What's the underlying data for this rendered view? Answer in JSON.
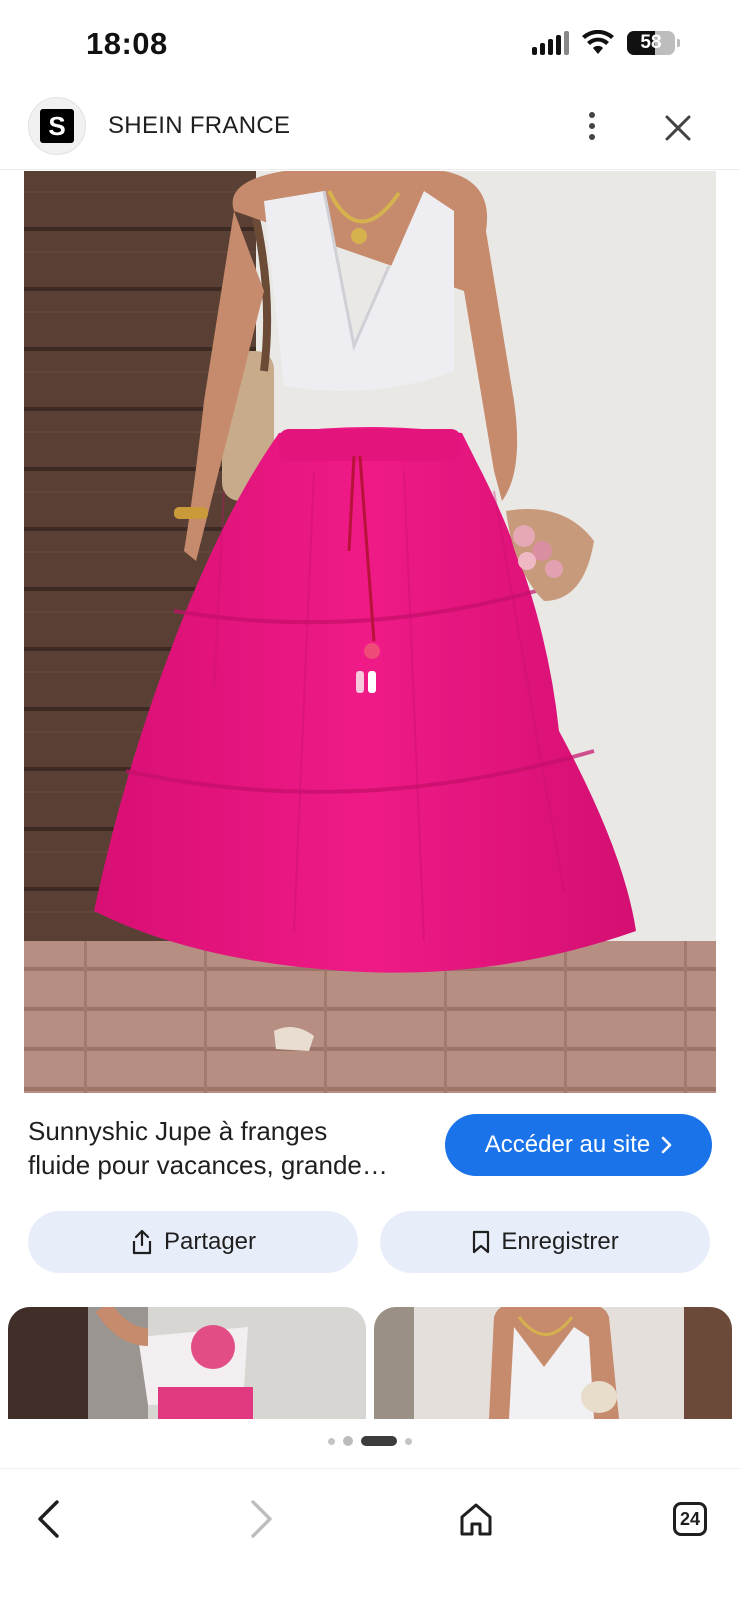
{
  "status_bar": {
    "time": "18:08",
    "battery_level": "58",
    "icons": [
      "cellular-signal-icon",
      "wifi-icon",
      "battery-icon"
    ]
  },
  "header": {
    "site_logo_letter": "S",
    "site_name": "SHEIN FRANCE",
    "menu_icon": "more-vertical-icon",
    "close_icon": "close-icon"
  },
  "product": {
    "title_line1": "Sunnyshic Jupe à franges",
    "title_line2": "fluide pour vacances, grande…",
    "visit_label": "Accéder au site",
    "skirt_color": "#e9157f"
  },
  "actions": {
    "share_label": "Partager",
    "save_label": "Enregistrer"
  },
  "carousel": {
    "active_index": 2,
    "dot_count": 4
  },
  "bottom_nav": {
    "tab_count": "24"
  },
  "colors": {
    "accent": "#1a73e8",
    "chip_bg": "#e8eef9"
  }
}
